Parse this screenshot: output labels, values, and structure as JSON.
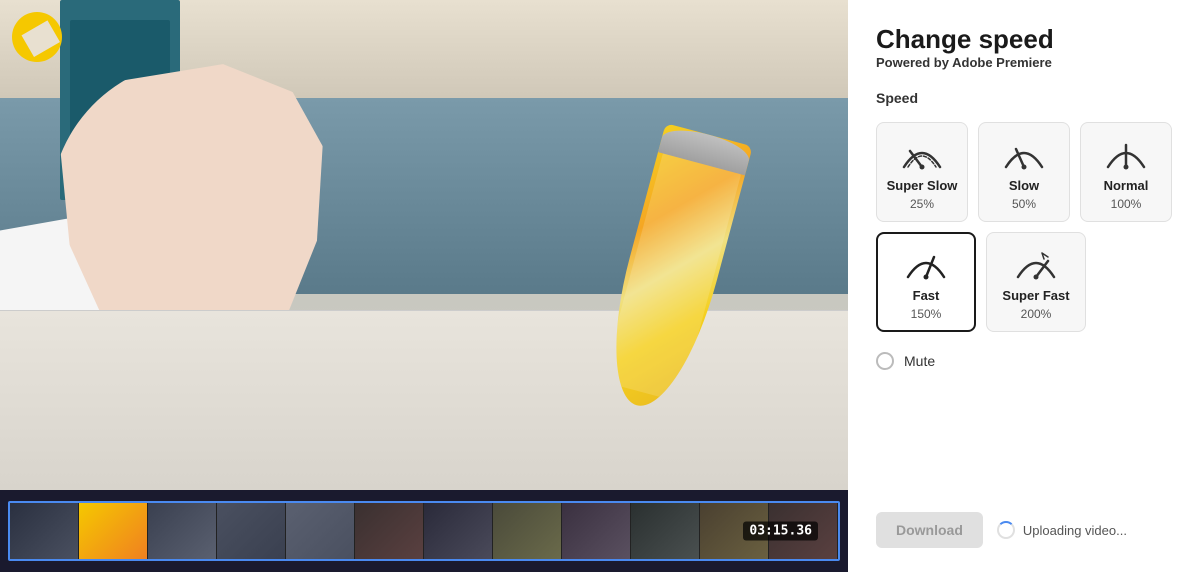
{
  "header": {
    "title": "Change speed",
    "subtitle_prefix": "Powered by ",
    "subtitle_brand": "Adobe Premiere"
  },
  "speed": {
    "label": "Speed",
    "options": [
      {
        "id": "super-slow",
        "name": "Super Slow",
        "percent": "25%",
        "active": false,
        "iconType": "super-slow"
      },
      {
        "id": "slow",
        "name": "Slow",
        "percent": "50%",
        "active": false,
        "iconType": "slow"
      },
      {
        "id": "normal",
        "name": "Normal",
        "percent": "100%",
        "active": false,
        "iconType": "normal"
      },
      {
        "id": "fast",
        "name": "Fast",
        "percent": "150%",
        "active": true,
        "iconType": "fast"
      },
      {
        "id": "super-fast",
        "name": "Super Fast",
        "percent": "200%",
        "active": false,
        "iconType": "super-fast"
      }
    ]
  },
  "mute": {
    "label": "Mute"
  },
  "timeline": {
    "timecode": "03:15.36"
  },
  "download": {
    "label": "Download",
    "upload_status": "Uploading video..."
  }
}
